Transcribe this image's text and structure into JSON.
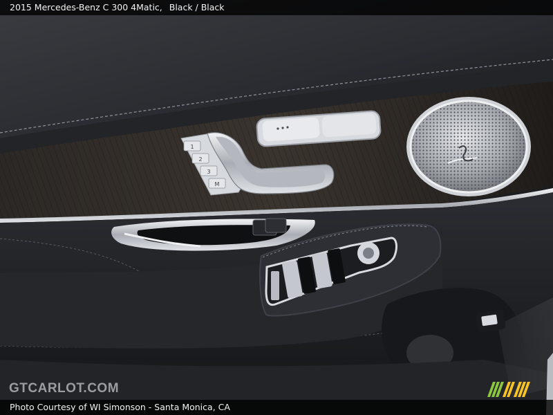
{
  "caption": {
    "title": "2015 Mercedes-Benz C 300 4Matic,",
    "subtitle": "Black / Black"
  },
  "footer": {
    "credit": "Photo Courtesy of WI Simonson - Santa Monica, CA"
  },
  "watermark": {
    "text": "GTCARLOT.COM"
  },
  "seat_memory_buttons": [
    "1",
    "2",
    "3",
    "M"
  ],
  "colors": {
    "topbar_bg": "#000000",
    "leather": "#1f2126",
    "wood_trim": "#2a2623",
    "chrome": "#c9ccd1",
    "logo_green": "#8dc63f",
    "logo_yellow": "#f7c325"
  }
}
